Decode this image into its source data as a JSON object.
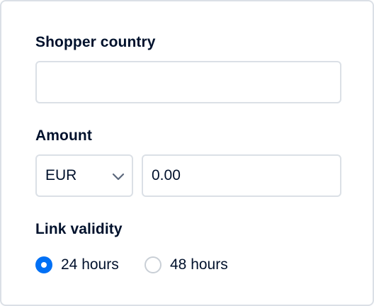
{
  "form": {
    "country": {
      "label": "Shopper country",
      "value": "",
      "placeholder": ""
    },
    "amount": {
      "label": "Amount",
      "currency": "EUR",
      "value": "0.00"
    },
    "validity": {
      "label": "Link validity",
      "options": [
        {
          "label": "24 hours",
          "selected": true
        },
        {
          "label": "48 hours",
          "selected": false
        }
      ]
    }
  },
  "colors": {
    "accent": "#0070f5",
    "border": "#dbe0e6",
    "text": "#00112c"
  }
}
